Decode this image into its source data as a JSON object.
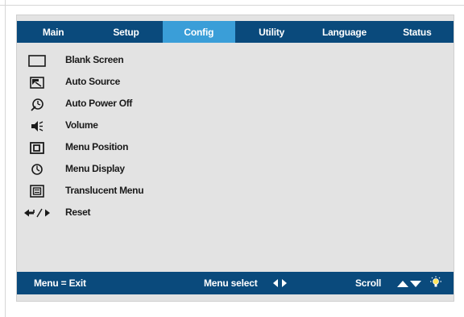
{
  "tabs": [
    {
      "label": "Main",
      "active": false
    },
    {
      "label": "Setup",
      "active": false
    },
    {
      "label": "Config",
      "active": true
    },
    {
      "label": "Utility",
      "active": false
    },
    {
      "label": "Language",
      "active": false
    },
    {
      "label": "Status",
      "active": false
    }
  ],
  "menu": {
    "items": [
      {
        "label": "Blank Screen",
        "icon": "blank-screen-icon"
      },
      {
        "label": "Auto Source",
        "icon": "auto-source-icon"
      },
      {
        "label": "Auto Power Off",
        "icon": "auto-power-off-icon"
      },
      {
        "label": "Volume",
        "icon": "volume-icon"
      },
      {
        "label": "Menu Position",
        "icon": "menu-position-icon"
      },
      {
        "label": "Menu Display",
        "icon": "menu-display-icon"
      },
      {
        "label": "Translucent Menu",
        "icon": "translucent-menu-icon"
      },
      {
        "label": "Reset",
        "icon": "reset-enter-icon"
      }
    ]
  },
  "statusbar": {
    "exit_text": "Menu = Exit",
    "select_text": "Menu select",
    "scroll_text": "Scroll"
  },
  "colors": {
    "bar": "#0a4a7c",
    "active_tab": "#3a9ed8",
    "panel": "#e3e3e3",
    "text": "#1a1a1a"
  }
}
